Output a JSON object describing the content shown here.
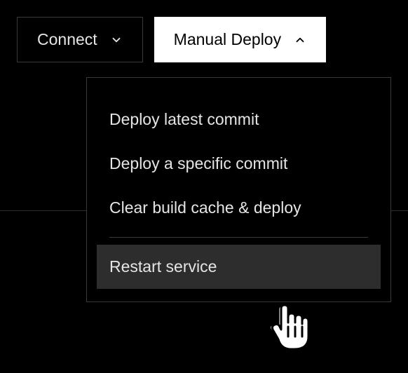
{
  "toolbar": {
    "connect_label": "Connect",
    "deploy_label": "Manual Deploy"
  },
  "menu": {
    "items": [
      {
        "label": "Deploy latest commit"
      },
      {
        "label": "Deploy a specific commit"
      },
      {
        "label": "Clear build cache & deploy"
      },
      {
        "label": "Restart service"
      }
    ]
  }
}
